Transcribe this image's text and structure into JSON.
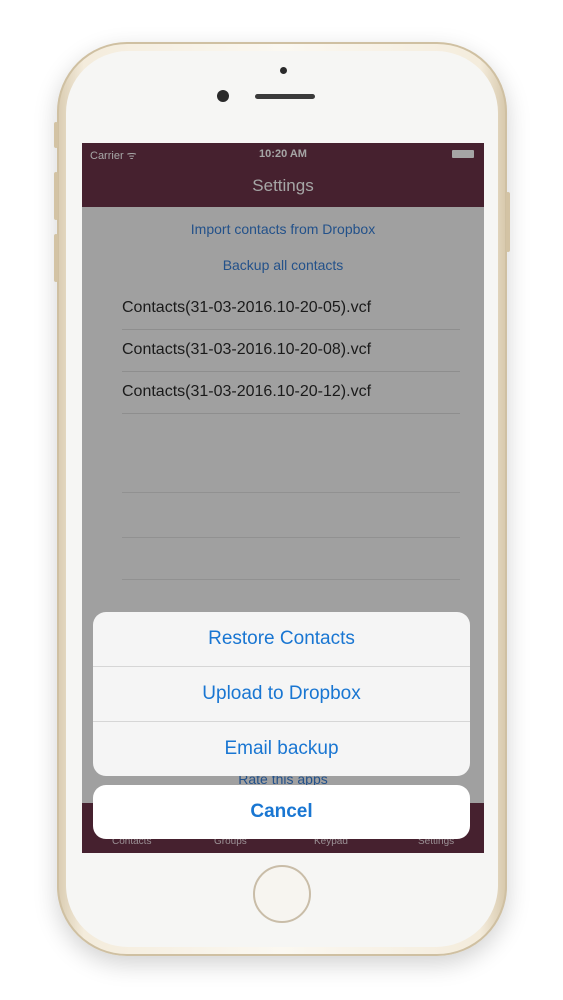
{
  "status_bar": {
    "carrier": "Carrier ᯤ",
    "time": "10:20 AM"
  },
  "nav": {
    "title": "Settings"
  },
  "actions": {
    "import": "Import contacts from Dropbox",
    "backup_all": "Backup all contacts"
  },
  "files": [
    "Contacts(31-03-2016.10-20-05).vcf",
    "Contacts(31-03-2016.10-20-08).vcf",
    "Contacts(31-03-2016.10-20-12).vcf"
  ],
  "rate_label": "Rate this apps",
  "tabs": [
    "Contacts",
    "Groups",
    "Keypad",
    "Settings"
  ],
  "action_sheet": {
    "items": [
      "Restore Contacts",
      "Upload to Dropbox",
      "Email backup"
    ],
    "cancel": "Cancel"
  },
  "colors": {
    "nav_bg": "#5c1c34",
    "accent": "#1976d2"
  }
}
